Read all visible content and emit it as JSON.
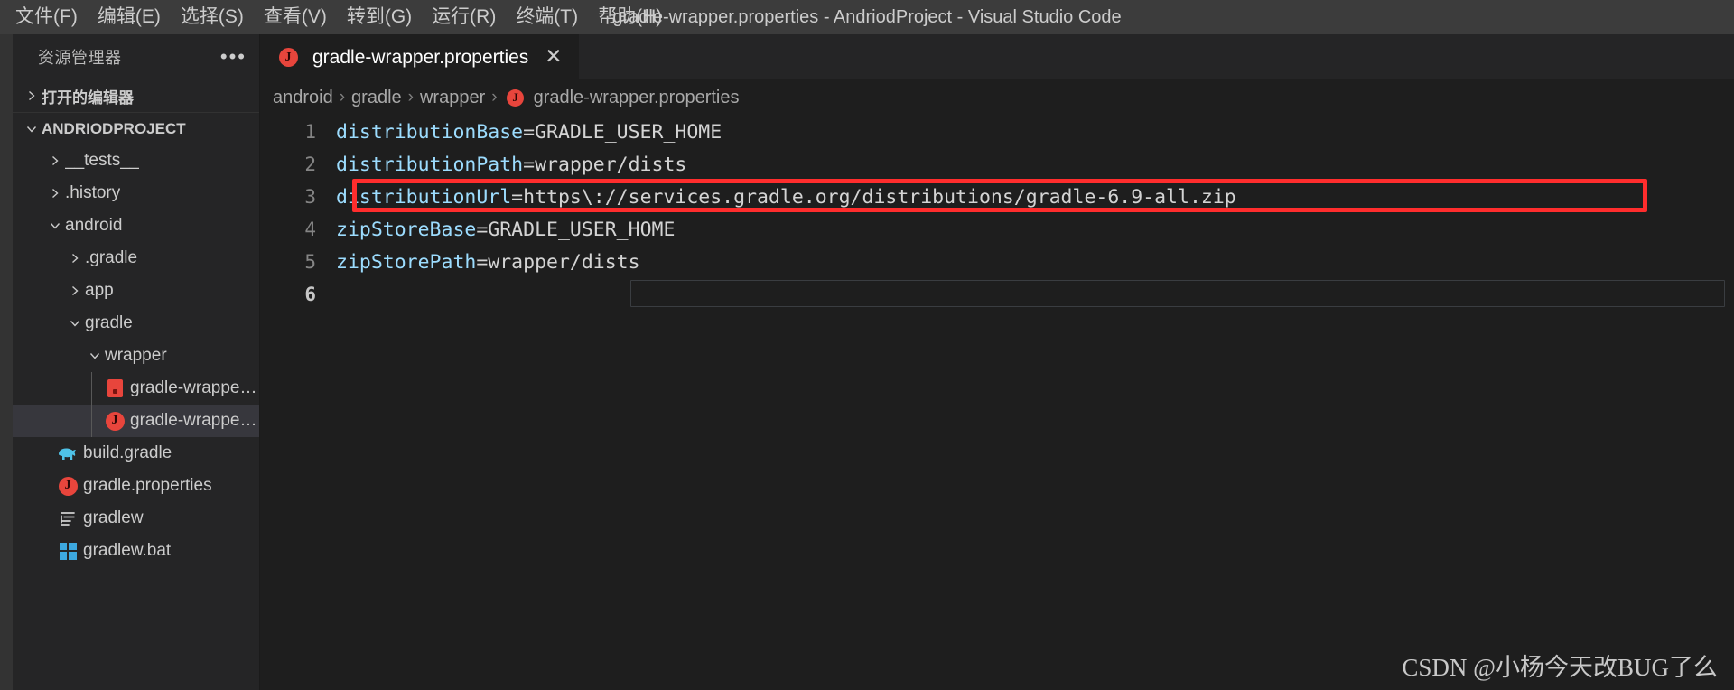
{
  "window": {
    "title": "gradle-wrapper.properties - AndriodProject - Visual Studio Code"
  },
  "menubar": [
    {
      "label": "文件(F)",
      "name": "menu-file"
    },
    {
      "label": "编辑(E)",
      "name": "menu-edit"
    },
    {
      "label": "选择(S)",
      "name": "menu-selection"
    },
    {
      "label": "查看(V)",
      "name": "menu-view"
    },
    {
      "label": "转到(G)",
      "name": "menu-go"
    },
    {
      "label": "运行(R)",
      "name": "menu-run"
    },
    {
      "label": "终端(T)",
      "name": "menu-terminal"
    },
    {
      "label": "帮助(H)",
      "name": "menu-help"
    }
  ],
  "sidebar": {
    "title": "资源管理器",
    "more_actions": "•••",
    "open_editors_label": "打开的编辑器",
    "project_label": "ANDRIODPROJECT",
    "tree": [
      {
        "label": "__tests__",
        "icon": "chevron-right",
        "depth": 1,
        "type": "folder"
      },
      {
        "label": ".history",
        "icon": "chevron-right",
        "depth": 1,
        "type": "folder"
      },
      {
        "label": "android",
        "icon": "chevron-down",
        "depth": 1,
        "type": "folder"
      },
      {
        "label": ".gradle",
        "icon": "chevron-right",
        "depth": 2,
        "type": "folder"
      },
      {
        "label": "app",
        "icon": "chevron-right",
        "depth": 2,
        "type": "folder"
      },
      {
        "label": "gradle",
        "icon": "chevron-down",
        "depth": 2,
        "type": "folder"
      },
      {
        "label": "wrapper",
        "icon": "chevron-down",
        "depth": 3,
        "type": "folder"
      },
      {
        "label": "gradle-wrapper.jar",
        "icon": "jar-icon",
        "depth": 4,
        "type": "file"
      },
      {
        "label": "gradle-wrapper.p...",
        "icon": "properties-icon",
        "depth": 4,
        "type": "file",
        "selected": true
      },
      {
        "label": "build.gradle",
        "icon": "gradle-elephant-icon",
        "depth": 2,
        "type": "file"
      },
      {
        "label": "gradle.properties",
        "icon": "properties-icon",
        "depth": 2,
        "type": "file"
      },
      {
        "label": "gradlew",
        "icon": "script-lines-icon",
        "depth": 2,
        "type": "file"
      },
      {
        "label": "gradlew.bat",
        "icon": "windows-icon",
        "depth": 2,
        "type": "file"
      }
    ]
  },
  "editor": {
    "tab": {
      "label": "gradle-wrapper.properties",
      "icon": "properties-icon",
      "close": "✕"
    },
    "breadcrumb": [
      {
        "label": "android",
        "icon": ""
      },
      {
        "label": "gradle",
        "icon": ""
      },
      {
        "label": "wrapper",
        "icon": ""
      },
      {
        "label": "gradle-wrapper.properties",
        "icon": "properties-icon"
      }
    ],
    "breadcrumb_separator": "›",
    "lines": [
      {
        "no": "1",
        "key": "distributionBase",
        "eq": "=",
        "value": "GRADLE_USER_HOME"
      },
      {
        "no": "2",
        "key": "distributionPath",
        "eq": "=",
        "value": "wrapper/dists"
      },
      {
        "no": "3",
        "key": "distributionUrl",
        "eq": "=",
        "value": "https\\://services.gradle.org/distributions/gradle-6.9-all.zip",
        "highlighted": true
      },
      {
        "no": "4",
        "key": "zipStoreBase",
        "eq": "=",
        "value": "GRADLE_USER_HOME"
      },
      {
        "no": "5",
        "key": "zipStorePath",
        "eq": "=",
        "value": "wrapper/dists"
      },
      {
        "no": "6",
        "key": "",
        "eq": "",
        "value": "",
        "cursor": true
      }
    ]
  },
  "annotation": {
    "color": "#ff2d2d",
    "target_line": "3"
  },
  "watermark": "CSDN @小杨今天改BUG了么"
}
